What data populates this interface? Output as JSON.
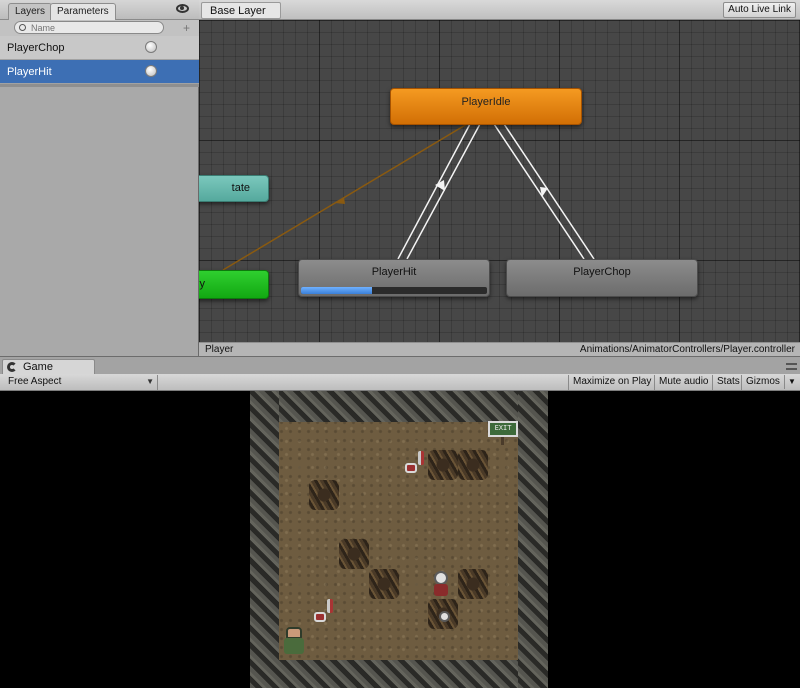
{
  "animator": {
    "tabs": {
      "layers": "Layers",
      "parameters": "Parameters"
    },
    "search": {
      "placeholder": "Name"
    },
    "parameters": [
      {
        "name": "PlayerChop",
        "type": "trigger",
        "selected": false
      },
      {
        "name": "PlayerHit",
        "type": "trigger",
        "selected": true
      }
    ],
    "breadcrumb": "Base Layer",
    "auto_live_link": "Auto Live Link",
    "states": {
      "idle": "PlayerIdle",
      "any": "tate",
      "entry": "y",
      "hit": "PlayerHit",
      "chop": "PlayerChop"
    },
    "hit_progress_percent": 38,
    "status": {
      "layer": "Player",
      "path": "Animations/AnimatorControllers/Player.controller"
    }
  },
  "game": {
    "tab_label": "Game",
    "aspect": "Free Aspect",
    "toolbar": {
      "maximize": "Maximize on Play",
      "mute": "Mute audio",
      "stats": "Stats",
      "gizmos": "Gizmos"
    },
    "exit_sign": "EXIT"
  },
  "colors": {
    "state_default": "#f59a21",
    "state_any": "#6bbbb0",
    "state_entry": "#1fbd1f",
    "selection": "#3d6fb4",
    "progress": "#4d93ef"
  },
  "icons": {
    "visibility": "eye-icon",
    "search": "search-icon",
    "add_parameter": "plus-icon",
    "game_tab": "pacman-icon",
    "tab_menu": "menu-icon"
  }
}
